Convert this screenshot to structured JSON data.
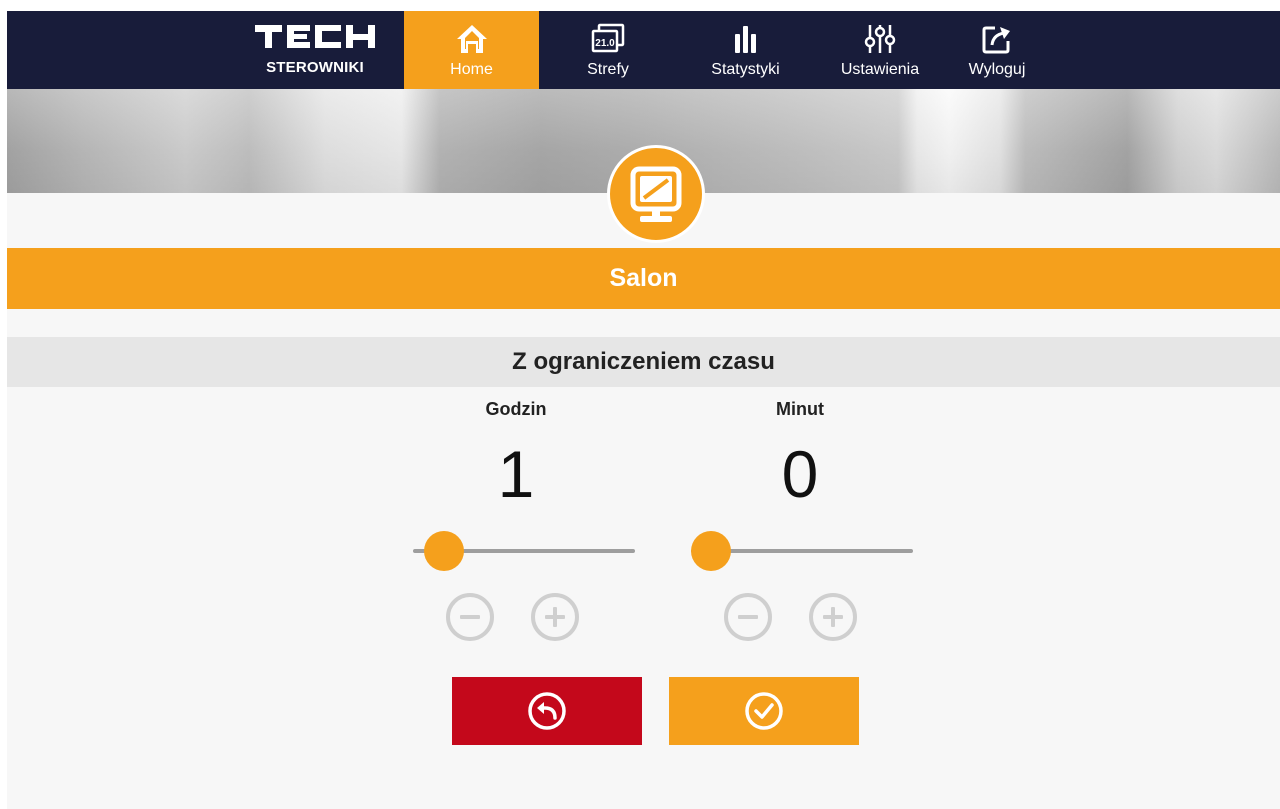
{
  "brand": {
    "name": "TECH",
    "subtitle": "STEROWNIKI"
  },
  "nav": {
    "items": [
      {
        "label": "Home",
        "icon": "home-icon",
        "active": true
      },
      {
        "label": "Strefy",
        "icon": "zones-icon",
        "badge": "21.0"
      },
      {
        "label": "Statystyki",
        "icon": "statistics-icon"
      },
      {
        "label": "Ustawienia",
        "icon": "settings-sliders-icon"
      },
      {
        "label": "Wyloguj",
        "icon": "logout-icon"
      }
    ]
  },
  "zone": {
    "name": "Salon",
    "icon": "monitor-icon"
  },
  "mode": {
    "title": "Z ograniczeniem czasu"
  },
  "timer": {
    "hours": {
      "label": "Godzin",
      "value": "1"
    },
    "minutes": {
      "label": "Minut",
      "value": "0"
    }
  },
  "actions": {
    "cancel_icon": "undo-icon",
    "confirm_icon": "check-circle-icon"
  },
  "colors": {
    "nav_bg": "#181c3a",
    "accent": "#f5a01c",
    "cancel": "#c4081b",
    "control_disabled": "#cfcfcf"
  }
}
